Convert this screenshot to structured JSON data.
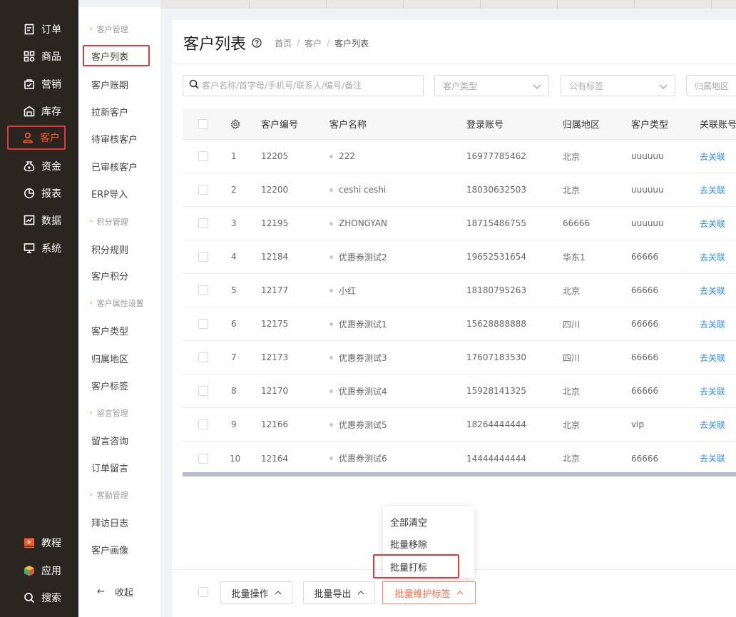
{
  "nav": {
    "items": [
      {
        "label": "订单",
        "icon": "order-icon"
      },
      {
        "label": "商品",
        "icon": "goods-icon"
      },
      {
        "label": "营销",
        "icon": "marketing-icon"
      },
      {
        "label": "库存",
        "icon": "warehouse-icon"
      },
      {
        "label": "客户",
        "icon": "user-icon",
        "active": true
      },
      {
        "label": "资金",
        "icon": "money-bag-icon"
      },
      {
        "label": "报表",
        "icon": "pie-chart-icon"
      },
      {
        "label": "数据",
        "icon": "data-icon"
      },
      {
        "label": "系统",
        "icon": "monitor-icon"
      }
    ],
    "bottom": [
      {
        "label": "教程",
        "icon": "video-icon"
      },
      {
        "label": "应用",
        "icon": "cube-icon"
      },
      {
        "label": "搜索",
        "icon": "search-icon"
      }
    ]
  },
  "submenu": {
    "groups": [
      "客户管理",
      "积分管理",
      "客户属性设置",
      "留言管理",
      "客勤管理"
    ],
    "items": [
      "客户列表",
      "客户账期",
      "拉新客户",
      "待审核客户",
      "已审核客户",
      "ERP导入",
      "积分规则",
      "客户积分",
      "客户类型",
      "归属地区",
      "客户标签",
      "留言咨询",
      "订单留言",
      "拜访日志",
      "客户画像"
    ],
    "collapse": "收起"
  },
  "page": {
    "title": "客户列表",
    "breadcrumb": [
      "首页",
      "客户",
      "客户列表"
    ]
  },
  "filters": {
    "search_placeholder": "客户名称/首字母/手机号/联系人/编号/备注",
    "customer_type": "客户类型",
    "public_tag": "公有标签",
    "region": "归属地区"
  },
  "table": {
    "headers": [
      "客户编号",
      "客户名称",
      "登录账号",
      "归属地区",
      "客户类型",
      "关联账号"
    ],
    "rows": [
      {
        "idx": "1",
        "code": "12205",
        "name": "222",
        "account": "16977785462",
        "region": "北京",
        "type": "uuuuuu",
        "link": "去关联"
      },
      {
        "idx": "2",
        "code": "12200",
        "name": "ceshi ceshi",
        "account": "18030632503",
        "region": "北京",
        "type": "uuuuuu",
        "link": "去关联"
      },
      {
        "idx": "3",
        "code": "12195",
        "name": "ZHONGYAN",
        "account": "18715486755",
        "region": "66666",
        "type": "uuuuuu",
        "link": "去关联"
      },
      {
        "idx": "4",
        "code": "12184",
        "name": "优惠券测试2",
        "account": "19652531654",
        "region": "华东1",
        "type": "66666",
        "link": "去关联"
      },
      {
        "idx": "5",
        "code": "12177",
        "name": "小红",
        "account": "18180795263",
        "region": "北京",
        "type": "66666",
        "link": "去关联"
      },
      {
        "idx": "6",
        "code": "12175",
        "name": "优惠券测试1",
        "account": "15628888888",
        "region": "四川",
        "type": "66666",
        "link": "去关联"
      },
      {
        "idx": "7",
        "code": "12173",
        "name": "优惠券测试3",
        "account": "17607183530",
        "region": "四川",
        "type": "66666",
        "link": "去关联"
      },
      {
        "idx": "8",
        "code": "12170",
        "name": "优惠券测试4",
        "account": "15928141325",
        "region": "北京",
        "type": "66666",
        "link": "去关联"
      },
      {
        "idx": "9",
        "code": "12166",
        "name": "优惠券测试5",
        "account": "18264444444",
        "region": "北京",
        "type": "vip",
        "link": "去关联"
      },
      {
        "idx": "10",
        "code": "12164",
        "name": "优惠券测试6",
        "account": "14444444444",
        "region": "北京",
        "type": "66666",
        "link": "去关联"
      }
    ]
  },
  "popup": {
    "items": [
      "全部清空",
      "批量移除",
      "批量打标"
    ]
  },
  "bottom": {
    "batch_ops": "批量操作",
    "batch_export": "批量导出",
    "batch_tags": "批量维护标签"
  },
  "colors": {
    "accent": "#ff5a2c",
    "highlight_border": "#e4393c",
    "link": "#2d8cf0",
    "nav_bg": "#2b2520"
  }
}
